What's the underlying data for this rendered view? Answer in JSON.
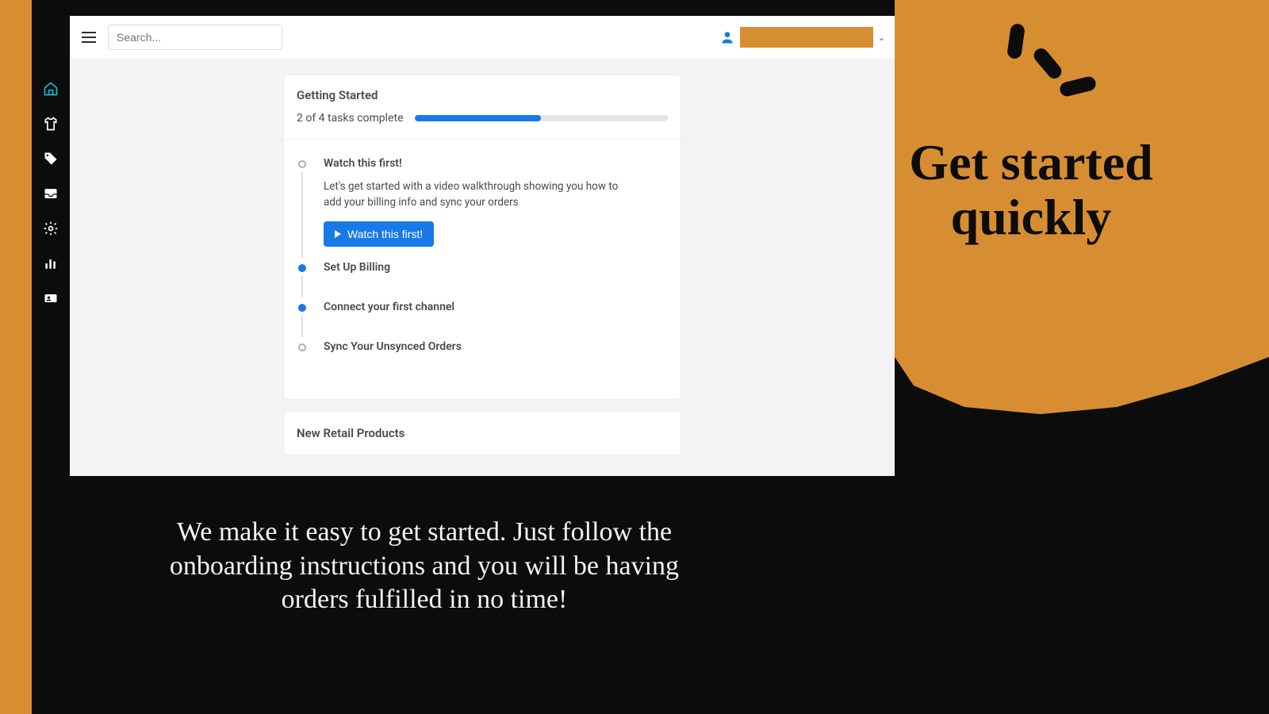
{
  "search": {
    "placeholder": "Search..."
  },
  "getting_started": {
    "title": "Getting Started",
    "progress_text": "2 of 4 tasks complete",
    "progress_pct": 50,
    "tasks": [
      {
        "title": "Watch this first!",
        "desc": "Let's get started with a video walkthrough showing you how to add your billing info and sync your orders",
        "cta": "Watch this first!",
        "done": false,
        "expanded": true
      },
      {
        "title": "Set Up Billing",
        "done": true
      },
      {
        "title": "Connect your first channel",
        "done": true
      },
      {
        "title": "Sync Your Unsynced Orders",
        "done": false
      }
    ]
  },
  "second_card": {
    "title": "New Retail Products"
  },
  "promo": {
    "headline": "Get started quickly",
    "sub": "We make it easy to get started. Just follow the onboarding instructions and you will be having orders fulfilled in no time!"
  }
}
